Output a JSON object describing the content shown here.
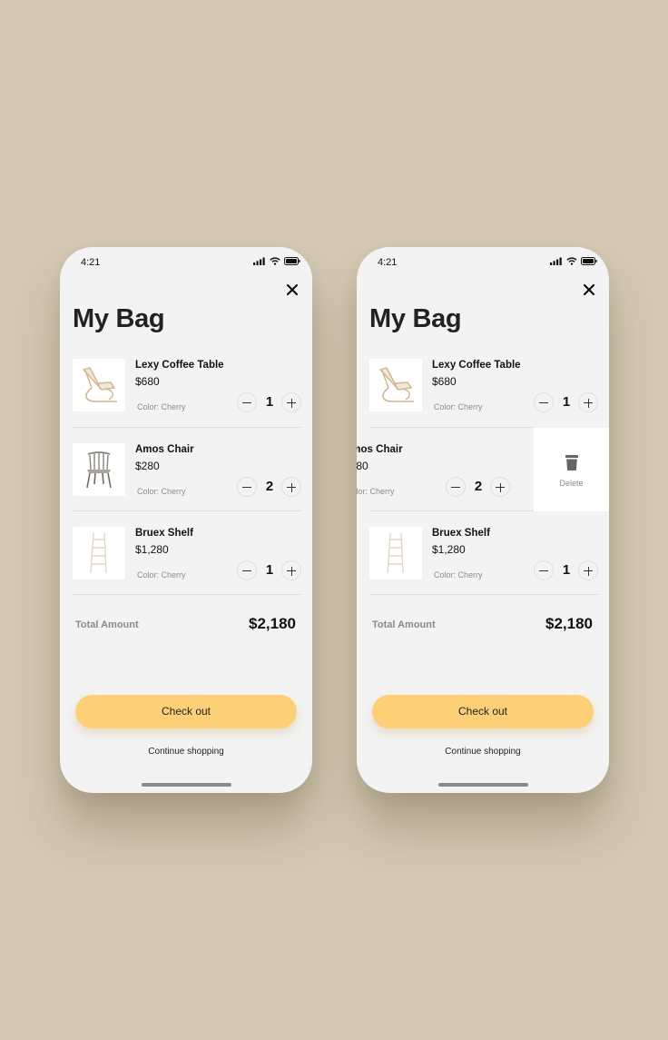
{
  "status": {
    "time": "4:21"
  },
  "title": "My Bag",
  "items": [
    {
      "name": "Lexy Coffee Table",
      "price": "$680",
      "color": "Color: Cherry",
      "qty": "1"
    },
    {
      "name": "Amos Chair",
      "price": "$280",
      "color": "Color: Cherry",
      "qty": "2"
    },
    {
      "name": "Bruex Shelf",
      "price": "$1,280",
      "color": "Color: Cherry",
      "qty": "1"
    }
  ],
  "total": {
    "label": "Total Amount",
    "value": "$2,180"
  },
  "checkout_label": "Check out",
  "continue_label": "Continue shopping",
  "delete_label": "Delete",
  "colors": {
    "background": "#d3c8b3",
    "screen": "#f3f3f3",
    "accent": "#fdd078"
  }
}
